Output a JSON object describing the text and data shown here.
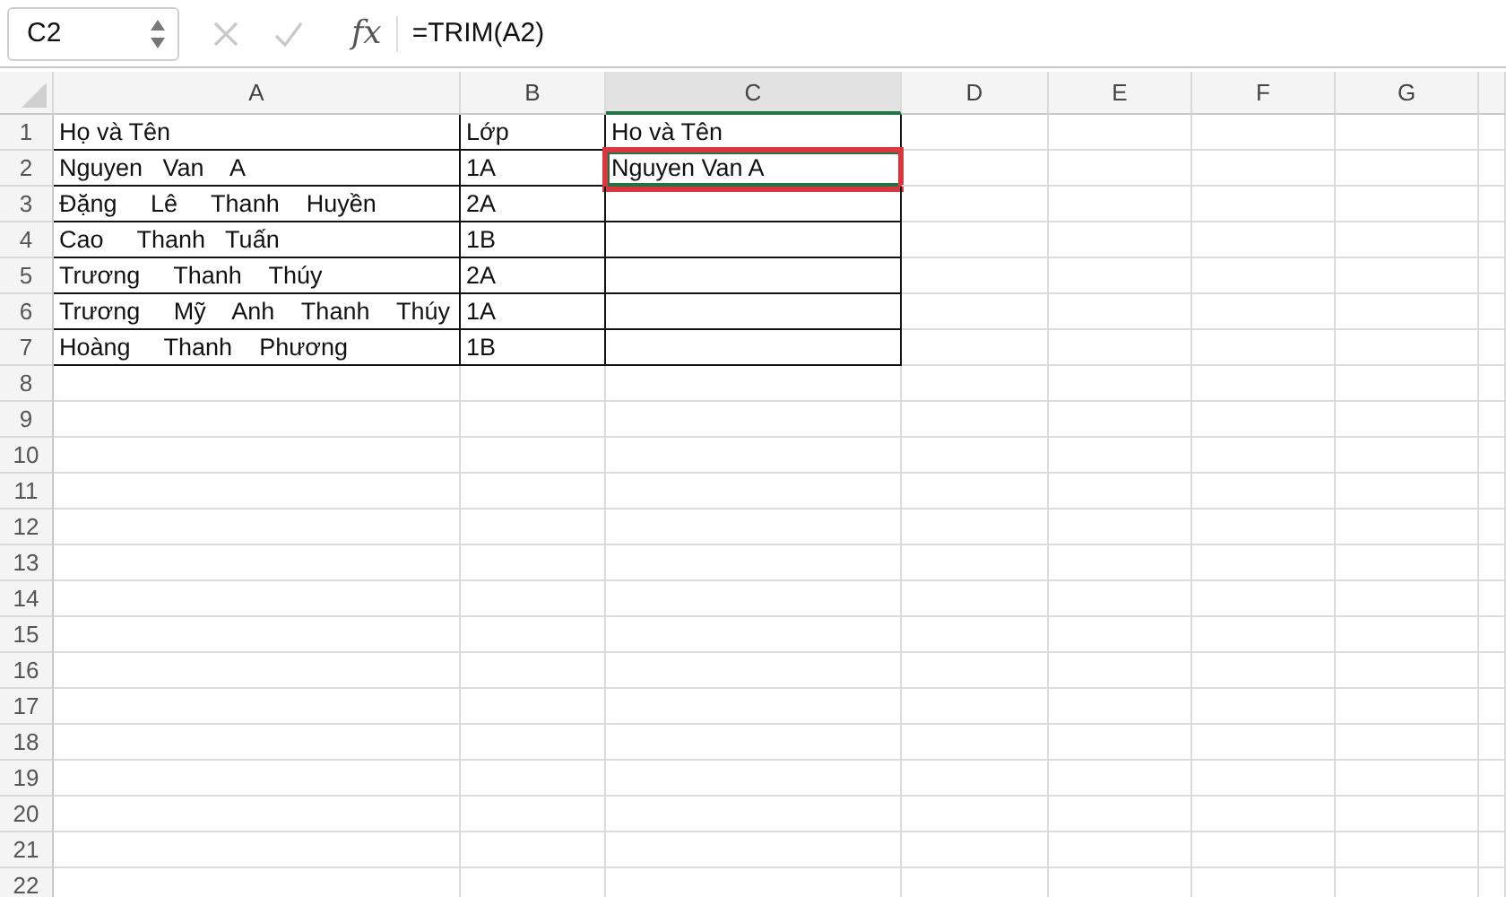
{
  "formula_bar": {
    "name_box": "C2",
    "fx": "fx",
    "formula": "=TRIM(A2)"
  },
  "columns": [
    {
      "label": "A",
      "selected": false
    },
    {
      "label": "B",
      "selected": false
    },
    {
      "label": "C",
      "selected": true
    },
    {
      "label": "D",
      "selected": false
    },
    {
      "label": "E",
      "selected": false
    },
    {
      "label": "F",
      "selected": false
    },
    {
      "label": "G",
      "selected": false
    }
  ],
  "rows": [
    {
      "number": "1",
      "cells": [
        {
          "text": "Họ và Tên",
          "selected": false
        },
        {
          "text": "Lớp",
          "selected": false
        },
        {
          "text": "Ho và Tên",
          "selected": false
        }
      ]
    },
    {
      "number": "2",
      "cells": [
        {
          "text": "Nguyen   Van    A",
          "selected": false
        },
        {
          "text": "1A",
          "selected": false
        },
        {
          "text": "Nguyen Van A",
          "selected": true
        }
      ]
    },
    {
      "number": "3",
      "cells": [
        {
          "text": "Đặng     Lê     Thanh    Huyền",
          "selected": false
        },
        {
          "text": "2A",
          "selected": false
        },
        {
          "selected": false
        }
      ]
    },
    {
      "number": "4",
      "cells": [
        {
          "text": "Cao     Thanh   Tuấn",
          "selected": false
        },
        {
          "text": "1B",
          "selected": false
        },
        {
          "selected": false
        }
      ]
    },
    {
      "number": "5",
      "cells": [
        {
          "text": "Trương     Thanh    Thúy",
          "selected": false
        },
        {
          "text": "2A",
          "selected": false
        },
        {
          "selected": false
        }
      ]
    },
    {
      "number": "6",
      "cells": [
        {
          "text": "Trương     Mỹ    Anh    Thanh    Thúy",
          "selected": false
        },
        {
          "text": "1A",
          "selected": false
        },
        {
          "selected": false
        }
      ]
    },
    {
      "number": "7",
      "cells": [
        {
          "text": "Hoàng     Thanh    Phương",
          "selected": false
        },
        {
          "text": "1B",
          "selected": false
        },
        {
          "selected": false
        }
      ]
    },
    {
      "number": "8"
    },
    {
      "number": "9"
    },
    {
      "number": "10"
    },
    {
      "number": "11"
    },
    {
      "number": "12"
    },
    {
      "number": "13"
    },
    {
      "number": "14"
    },
    {
      "number": "15"
    },
    {
      "number": "16"
    },
    {
      "number": "17"
    },
    {
      "number": "18"
    },
    {
      "number": "19"
    },
    {
      "number": "20"
    },
    {
      "number": "21"
    },
    {
      "number": "22"
    }
  ]
}
